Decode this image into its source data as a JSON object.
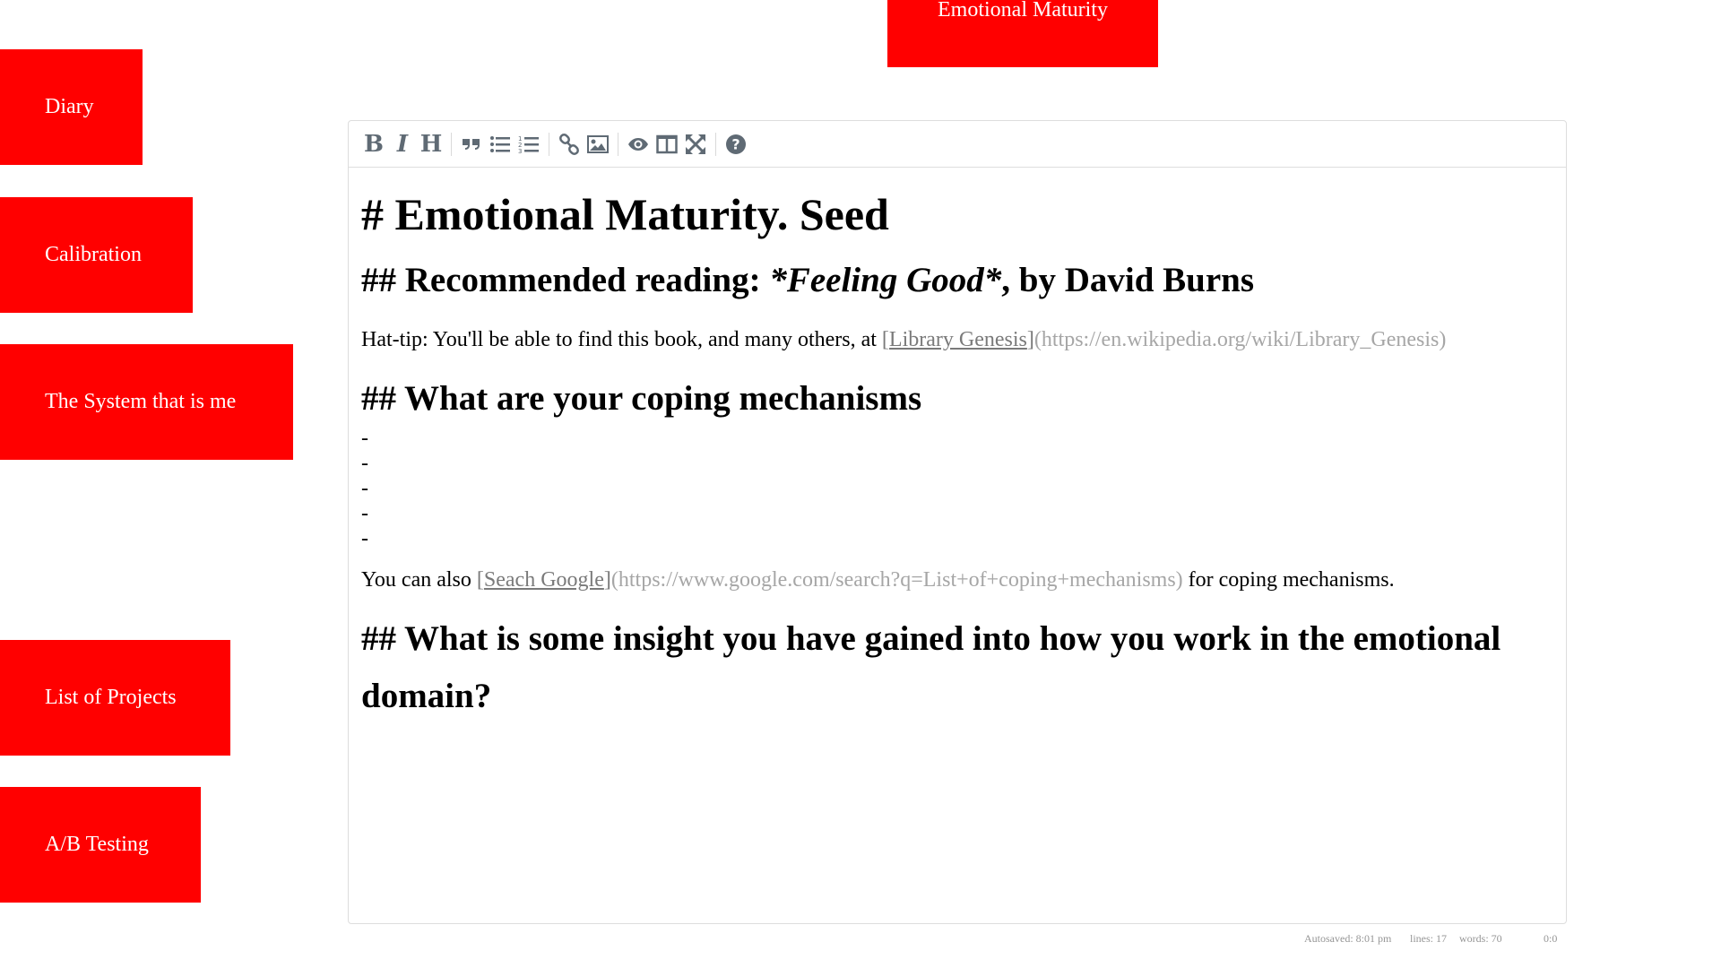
{
  "nav": {
    "diary": "Diary",
    "calibration": "Calibration",
    "system": "The System that is me",
    "projects": "List of Projects",
    "ab_testing": "A/B Testing"
  },
  "page_title_button": "Emotional Maturity",
  "toolbar": {
    "bold": "B",
    "italic": "I",
    "heading": "H",
    "icons": [
      "bold-icon",
      "italic-icon",
      "heading-icon",
      "quote-icon",
      "unordered-list-icon",
      "ordered-list-icon",
      "link-icon",
      "image-icon",
      "preview-icon",
      "side-by-side-icon",
      "fullscreen-icon",
      "help-icon"
    ]
  },
  "doc": {
    "h1": "# Emotional Maturity. Seed",
    "h2_reading_prefix": "## Recommended reading: ",
    "h2_reading_em": "*Feeling Good*",
    "h2_reading_suffix": ", by David Burns",
    "hat_tip_prefix": "Hat-tip: You'll be able to find this book, and many others, at ",
    "lib_bracket_open": "[",
    "lib_link_text": "Library Genesis",
    "lib_bracket_close": "]",
    "lib_url": "(https://en.wikipedia.org/wiki/Library_Genesis)",
    "h2_coping": "## What are your coping mechanisms",
    "list_items": [
      "-",
      "-",
      "-",
      "-",
      "-"
    ],
    "also_prefix": "You can also ",
    "google_bracket_open": "[",
    "google_link_text": "Seach Google",
    "google_bracket_close": "]",
    "google_url": "(https://www.google.com/search?q=List+of+coping+mechanisms)",
    "also_suffix": " for coping mechanisms.",
    "h2_insight": "## What is some insight you have gained into how you work in the emotional domain?"
  },
  "status": {
    "autosave": "Autosaved: 8:01 pm",
    "lines": "lines: 17",
    "words": "words: 70",
    "cursor": "0:0"
  },
  "colors": {
    "nav_bg": "#ff0000",
    "icon": "#5f6a74",
    "url": "#a6a6a6"
  }
}
